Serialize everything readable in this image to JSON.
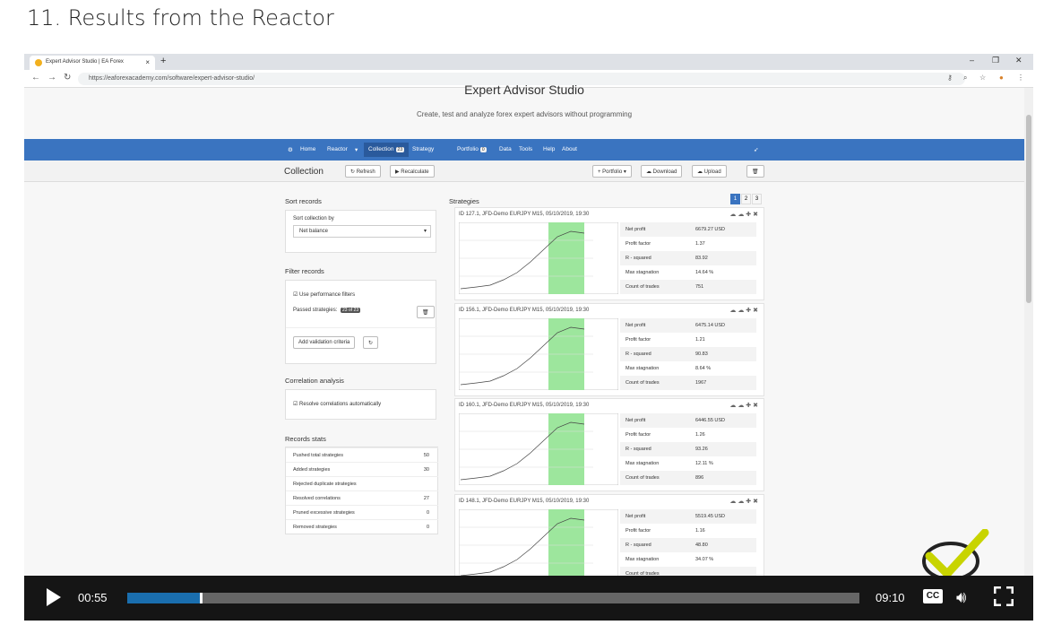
{
  "lesson": {
    "title": "11. Results from the Reactor"
  },
  "browser": {
    "tab_title": "Expert Advisor Studio | EA Forex",
    "tab_close": "×",
    "new_tab": "+",
    "url": "https://eaforexacademy.com/software/expert-advisor-studio/"
  },
  "app": {
    "title": "Expert Advisor Studio",
    "subtitle": "Create, test and analyze forex expert advisors without programming"
  },
  "nav": {
    "items": [
      "Home",
      "Reactor",
      "Collection",
      "Strategy",
      "Portfolio",
      "Data",
      "Tools",
      "Help",
      "About"
    ],
    "collection_badge": "23",
    "portfolio_badge": "0"
  },
  "toolbar": {
    "title": "Collection",
    "refresh": "Refresh",
    "recalculate": "Recalculate",
    "portfolio": "Portfolio",
    "download": "Download",
    "upload": "Upload"
  },
  "left": {
    "sort_title": "Sort records",
    "sort_by_label": "Sort collection by",
    "sort_by_value": "Net balance",
    "filter_title": "Filter records",
    "use_filters": "Use performance filters",
    "passed_label": "Passed strategies:",
    "passed_badge": "23 of 23",
    "add_validation": "Add validation criteria",
    "corr_title": "Correlation analysis",
    "resolve_corr": "Resolve correlations automatically",
    "stats_title": "Records stats",
    "stats": [
      {
        "label": "Pushed total strategies",
        "value": "50"
      },
      {
        "label": "Added strategies",
        "value": "30"
      },
      {
        "label": "Rejected duplicate strategies",
        "value": ""
      },
      {
        "label": "Resolved correlations",
        "value": "27"
      },
      {
        "label": "Pruned excessive strategies",
        "value": "0"
      },
      {
        "label": "Removed strategies",
        "value": "0"
      }
    ]
  },
  "strategies": {
    "title": "Strategies",
    "pages": [
      "1",
      "2",
      "3"
    ],
    "metric_labels": [
      "Net profit",
      "Profit factor",
      "R - squared",
      "Max stagnation",
      "Count of trades"
    ],
    "cards": [
      {
        "header": "ID 127.1, JFD-Demo EURJPY M15, 05/10/2019, 19:30",
        "values": [
          "6679.27 USD",
          "1.37",
          "83.92",
          "14.64 %",
          "751"
        ]
      },
      {
        "header": "ID 156.1, JFD-Demo EURJPY M15, 05/10/2019, 19:30",
        "values": [
          "6475.14 USD",
          "1.21",
          "90.83",
          "8.64 %",
          "1967"
        ]
      },
      {
        "header": "ID 160.1, JFD-Demo EURJPY M15, 05/10/2019, 19:30",
        "values": [
          "6446.55 USD",
          "1.26",
          "93.26",
          "12.11 %",
          "896"
        ]
      },
      {
        "header": "ID 148.1, JFD-Demo EURJPY M15, 05/10/2019, 19:30",
        "values": [
          "5519.45 USD",
          "1.16",
          "48.80",
          "34.07 %",
          ""
        ]
      }
    ]
  },
  "video": {
    "current_time": "00:55",
    "duration": "09:10",
    "progress": 0.1,
    "cc": "CC"
  },
  "colors": {
    "nav": "#3a74c0",
    "progress": "#1a6eae",
    "controls": "#151515",
    "chart_highlight": "#9de69d"
  }
}
